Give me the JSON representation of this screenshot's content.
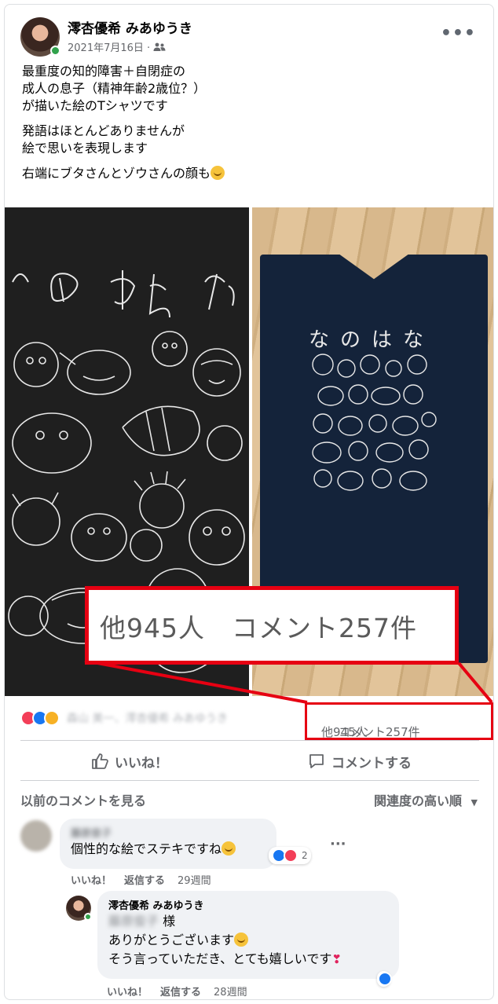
{
  "post": {
    "author": "澪杏優希 みあゆうき",
    "date": "2021年7月16日 ·",
    "lines": [
      "最重度の知的障害＋自閉症の\n成人の息子（精神年齢2歳位？）\nが描いた絵のTシャツです",
      "発語はほとんどありませんが\n絵で思いを表現します",
      "右端にブタさんとゾウさんの顔も"
    ],
    "shirt_text": "なのはな",
    "icons": [
      "audience-friends-icon",
      "more-options-icon",
      "smile-emoji-icon"
    ]
  },
  "engagement": {
    "callout_text": "他945人　コメント257件",
    "names_blurred": "森山 美一、澪杏優希 みあゆうき",
    "others_count": "他945人",
    "comments_count": "コメント257件",
    "reactions": [
      "love",
      "like",
      "care"
    ]
  },
  "actions": {
    "like": "いいね！",
    "comment": "コメントする"
  },
  "comments_header": {
    "previous": "以前のコメントを見る",
    "sort": "関連度の高い順"
  },
  "comments": [
    {
      "name_blurred": "藤原俊子",
      "text": "個性的な絵でステキですね",
      "reaction_count": "2",
      "like": "いいね！",
      "reply": "返信する",
      "time": "29週間"
    },
    {
      "name": "澪杏優希 みあゆうき",
      "addressee_blurred": "藤原俊子",
      "honorific": "様",
      "line1": "ありがとうございます",
      "line2": "そう言っていただき、とても嬉しいです",
      "like": "いいね！",
      "reply": "返信する",
      "time": "28週間"
    }
  ],
  "colors": {
    "callout_red": "#e60012",
    "online_green": "#31a24c",
    "like_blue": "#1877f2",
    "love_red": "#f33e58"
  }
}
